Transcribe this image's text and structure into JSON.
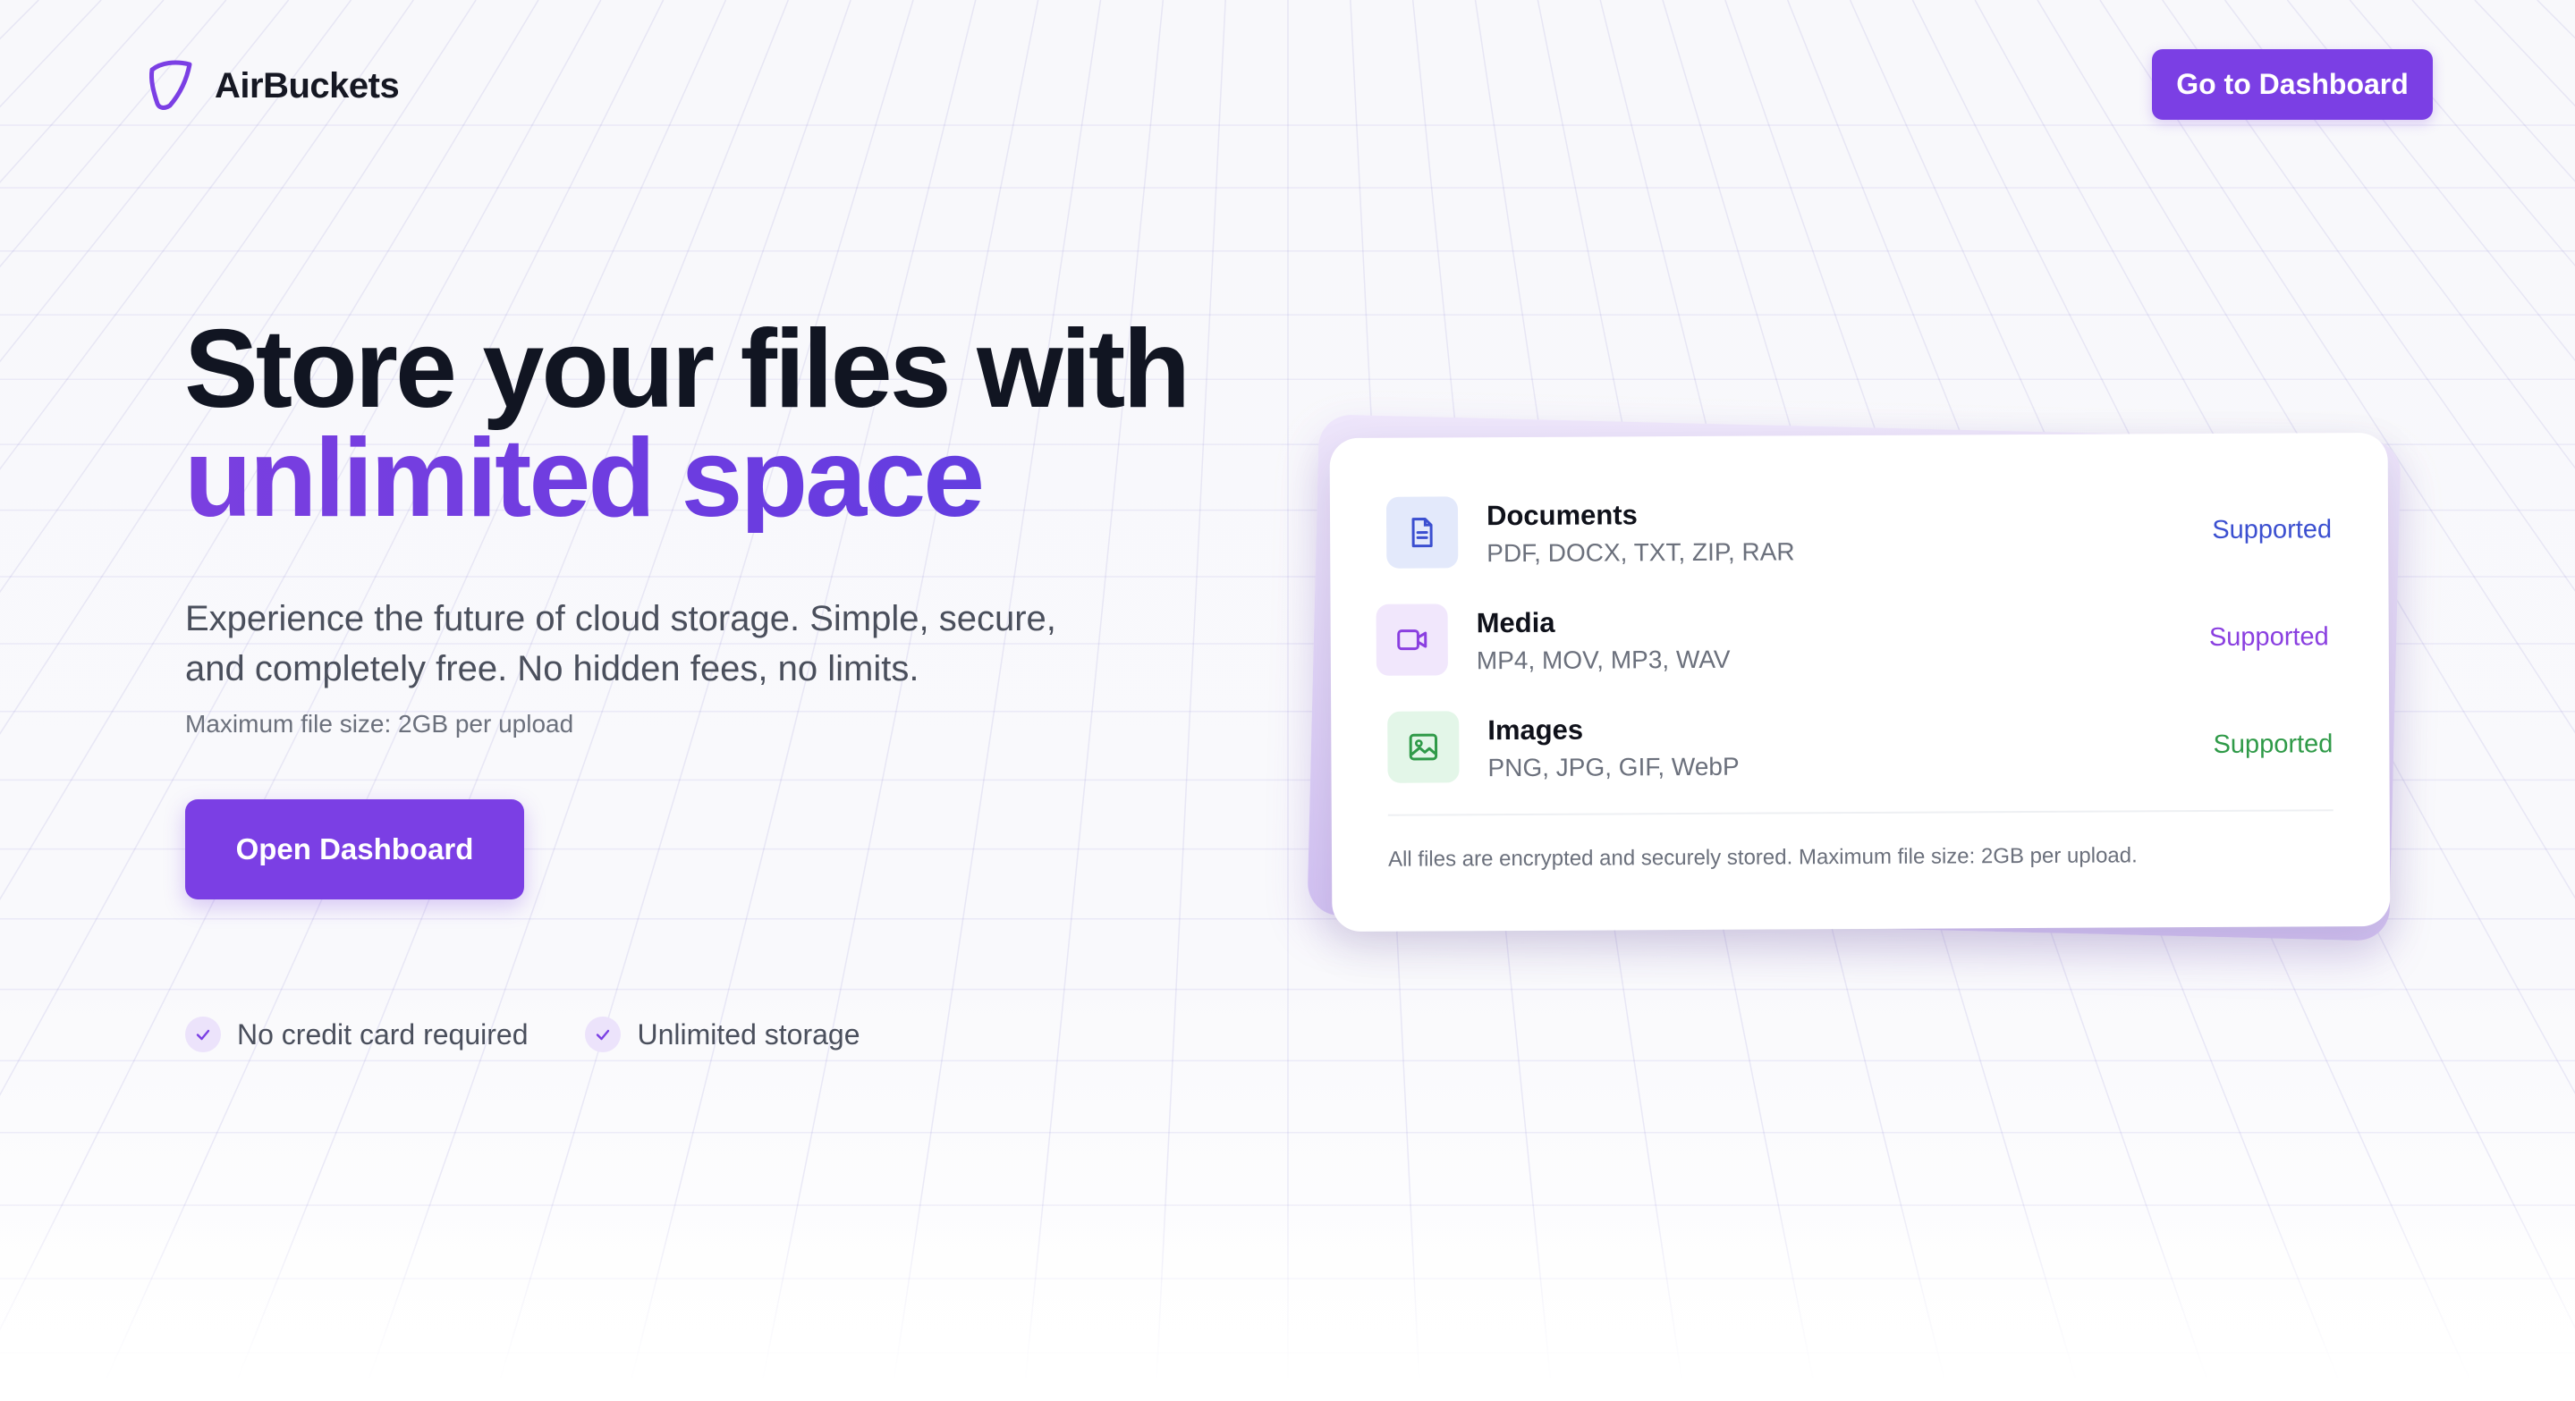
{
  "header": {
    "brand": "AirBuckets",
    "cta_label": "Go to Dashboard"
  },
  "hero": {
    "title_line1": "Store your files with",
    "title_line2": "unlimited space",
    "subtitle": "Experience the future of cloud storage. Simple, secure, and completely free. No hidden fees, no limits.",
    "note": "Maximum file size: 2GB per upload",
    "cta_label": "Open Dashboard",
    "features": [
      "No credit card required",
      "Unlimited storage"
    ]
  },
  "card": {
    "rows": [
      {
        "name": "Documents",
        "types": "PDF, DOCX, TXT, ZIP, RAR",
        "status": "Supported",
        "icon": "document-icon",
        "color": "#3b4fd0",
        "bg": "#e3e9fb"
      },
      {
        "name": "Media",
        "types": "MP4, MOV, MP3, WAV",
        "status": "Supported",
        "icon": "video-icon",
        "color": "#8a3fe0",
        "bg": "#f1e7fc"
      },
      {
        "name": "Images",
        "types": "PNG, JPG, GIF, WebP",
        "status": "Supported",
        "icon": "image-icon",
        "color": "#2f9a48",
        "bg": "#e3f6e8"
      }
    ],
    "footer": "All files are encrypted and securely stored. Maximum file size: 2GB per upload."
  },
  "colors": {
    "brand": "#7b3fe4",
    "title": "#111522",
    "accent": "#7a3fe0"
  }
}
